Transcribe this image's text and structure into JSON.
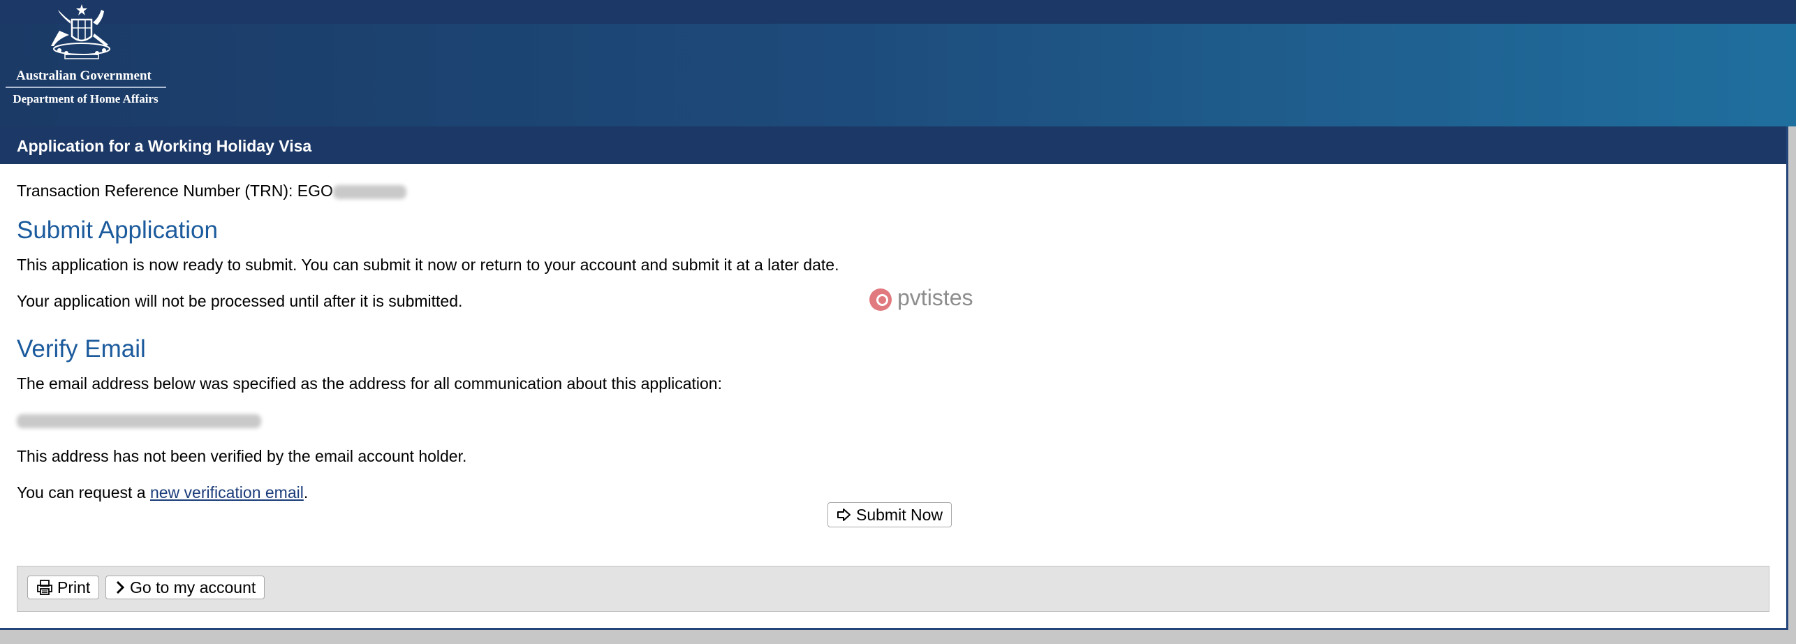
{
  "header": {
    "gov_name": "Australian Government",
    "dept_name": "Department of Home Affairs",
    "crest_icon": "australian-coat-of-arms-icon",
    "colors": {
      "banner": "#1c3866",
      "heading": "#1b5a9c"
    }
  },
  "title_bar": {
    "title": "Application for a Working Holiday Visa"
  },
  "trn": {
    "label": "Transaction Reference Number (TRN): EGO"
  },
  "submit_section": {
    "heading": "Submit Application",
    "line1": "This application is now ready to submit. You can submit it now or return to your account and submit it at a later date.",
    "line2": "Your application will not be processed until after it is submitted."
  },
  "verify_section": {
    "heading": "Verify Email",
    "intro": "The email address below was specified as the address for all communication about this application:",
    "not_verified": "This address has not been verified by the email account holder.",
    "request_prefix": "You can request a ",
    "request_link": "new verification email",
    "request_suffix": "."
  },
  "watermark": {
    "text": "pvtistes"
  },
  "buttons": {
    "submit_now": "Submit Now",
    "print": "Print",
    "go_to_account": "Go to my account"
  }
}
